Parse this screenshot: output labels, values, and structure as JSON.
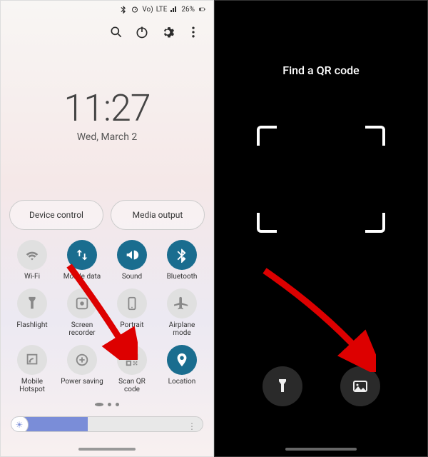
{
  "statusbar": {
    "carrier1": "Vo)",
    "carrier2": "LTE",
    "sig": "LTE2",
    "battery": "26%"
  },
  "toolbar": {
    "search": "Search",
    "power": "Power",
    "settings": "Settings",
    "more": "More"
  },
  "clock": {
    "time": "11:27",
    "date": "Wed, March 2"
  },
  "bigbtns": {
    "device": "Device control",
    "media": "Media output"
  },
  "tiles": [
    {
      "id": "wifi",
      "label": "Wi-Fi",
      "on": false,
      "icon": "wifi"
    },
    {
      "id": "mobile-data",
      "label": "Mobile data",
      "on": true,
      "icon": "arrows"
    },
    {
      "id": "sound",
      "label": "Sound",
      "on": true,
      "icon": "sound"
    },
    {
      "id": "bluetooth",
      "label": "Bluetooth",
      "on": true,
      "icon": "bluetooth"
    },
    {
      "id": "flashlight",
      "label": "Flashlight",
      "on": false,
      "icon": "flash"
    },
    {
      "id": "screen-recorder",
      "label": "Screen recorder",
      "on": false,
      "icon": "record"
    },
    {
      "id": "portrait",
      "label": "Portrait",
      "on": false,
      "icon": "portrait"
    },
    {
      "id": "airplane",
      "label": "Airplane mode",
      "on": false,
      "icon": "airplane"
    },
    {
      "id": "hotspot",
      "label": "Mobile Hotspot",
      "on": false,
      "icon": "hotspot"
    },
    {
      "id": "power-saving",
      "label": "Power saving",
      "on": false,
      "icon": "powersave"
    },
    {
      "id": "scan-qr",
      "label": "Scan QR code",
      "on": false,
      "icon": "qr"
    },
    {
      "id": "location",
      "label": "Location",
      "on": true,
      "icon": "location"
    }
  ],
  "brightness": {
    "sun": "☀",
    "more": "⋮"
  },
  "scanner": {
    "title": "Find a QR code",
    "flash": "Flashlight",
    "gallery": "Gallery"
  }
}
